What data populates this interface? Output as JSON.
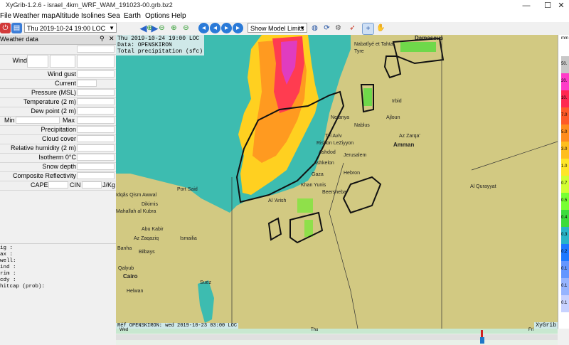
{
  "window": {
    "title": "XyGrib-1.2.6 - israel_4km_WRF_WAM_191023-00.grb.bz2",
    "minimize": "—",
    "maximize": "☐",
    "close": "✕"
  },
  "menu": [
    "File",
    "Weather map",
    "Altitude",
    "Isolines",
    "Sea",
    "Earth",
    "Options",
    "Help"
  ],
  "toolbar": {
    "date_value": "Thu 2019-10-24 19:00 LOC",
    "model_limits": "Show Model Limits"
  },
  "weather_panel": {
    "title": "Weather data",
    "rows": [
      "Wind gust",
      "Current",
      "Pressure (MSL)",
      "Temperature (2 m)",
      "Dew point (2 m)",
      "Precipitation",
      "Cloud cover",
      "Relative humidity (2 m)",
      "Isotherm 0°C",
      "Snow depth",
      "Composite Reflectivity"
    ],
    "wind_label": "Wind",
    "min_label": "Min",
    "max_label": "Max",
    "cape_label": "CAPE",
    "cin_label": "CIN",
    "cape_unit": "J/Kg",
    "wave_lines": [
      "ig  :",
      "ax  :",
      "well:",
      "ind :",
      "rim :",
      "cdy :",
      "hitcap (prob):"
    ]
  },
  "map": {
    "overlay": [
      "Thu 2019-10-24 19:00 LOC",
      "Data: OPENSKIRON",
      "Total precipitation (sfc)"
    ],
    "reference": "Réf OPENSKIRON: wed 2019-10-23 03:00 LOC",
    "brand": "XyGrib",
    "cities": [
      "Nabatîyé et Tahta",
      "Tyre",
      "Damascus",
      "Irbid",
      "Ajloun",
      "Netanya",
      "Nablus",
      "Tel Aviv",
      "Rishon LeZiyyon",
      "Az Zarqa'",
      "Amman",
      "Ashdod",
      "Jerusalem",
      "Ashkelon",
      "Gaza",
      "Hebron",
      "Khan Yunis",
      "Beersheba",
      "Port Said",
      "Al 'Arish",
      "Al Qurayyat",
      "Idqâs Qism Awwal",
      "Dikirnis",
      "Mahallah al Kubra",
      "Abu Kabir",
      "Ismailia",
      "Az Zaqaziq",
      "Banha",
      "Bilbays",
      "Qalyub",
      "Cairo",
      "Suez",
      "Helwan"
    ]
  },
  "scale": {
    "unit": "mm",
    "labels": [
      "50.",
      "20.",
      "10.",
      "7.0",
      "5.0",
      "3.0",
      "1.0",
      "0.7",
      "0.5",
      "0.4",
      "0.3",
      "0.2",
      "0.1",
      "0.1",
      "0.1"
    ],
    "colors": [
      "#c8c8c8",
      "#ff3cc8",
      "#ff2850",
      "#ff5a28",
      "#ff8c1e",
      "#ffbe1e",
      "#ffe628",
      "#d2ff32",
      "#78ff32",
      "#3cdc3c",
      "#28b4c8",
      "#1e78ff",
      "#6496ff",
      "#96b4ff",
      "#c8d2ff"
    ]
  },
  "timeline": {
    "days": [
      "Wed",
      "Thu",
      "Fri"
    ]
  }
}
